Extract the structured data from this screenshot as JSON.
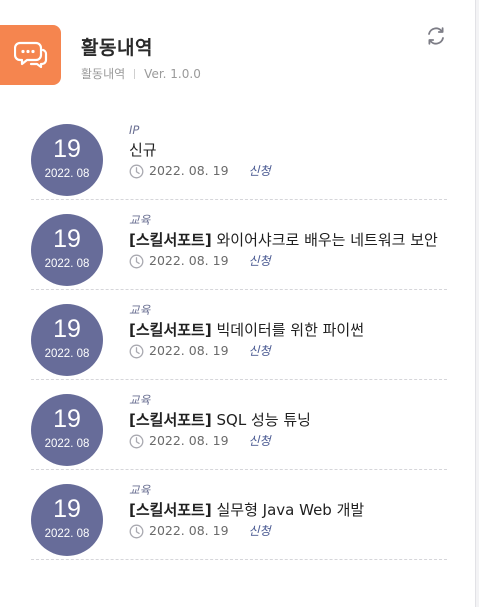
{
  "header": {
    "title": "활동내역",
    "subtitle_name": "활동내역",
    "version": "Ver. 1.0.0",
    "icons": {
      "app": "chat-bubbles-icon",
      "refresh": "refresh-icon"
    }
  },
  "colors": {
    "accent": "#f5854f",
    "badge": "#676c99",
    "status": "#4a5a92"
  },
  "activities": [
    {
      "day": "19",
      "year_month": "2022. 08",
      "category": "IP",
      "tag": "",
      "title": "신규",
      "date": "2022. 08. 19",
      "status": "신청"
    },
    {
      "day": "19",
      "year_month": "2022. 08",
      "category": "교육",
      "tag": "[스킬서포트]",
      "title": "와이어샤크로 배우는 네트워크 보안",
      "date": "2022. 08. 19",
      "status": "신청"
    },
    {
      "day": "19",
      "year_month": "2022. 08",
      "category": "교육",
      "tag": "[스킬서포트]",
      "title": "빅데이터를 위한 파이썬",
      "date": "2022. 08. 19",
      "status": "신청"
    },
    {
      "day": "19",
      "year_month": "2022. 08",
      "category": "교육",
      "tag": "[스킬서포트]",
      "title": "SQL 성능 튜닝",
      "date": "2022. 08. 19",
      "status": "신청"
    },
    {
      "day": "19",
      "year_month": "2022. 08",
      "category": "교육",
      "tag": "[스킬서포트]",
      "title": "실무형 Java Web 개발",
      "date": "2022. 08. 19",
      "status": "신청"
    }
  ]
}
